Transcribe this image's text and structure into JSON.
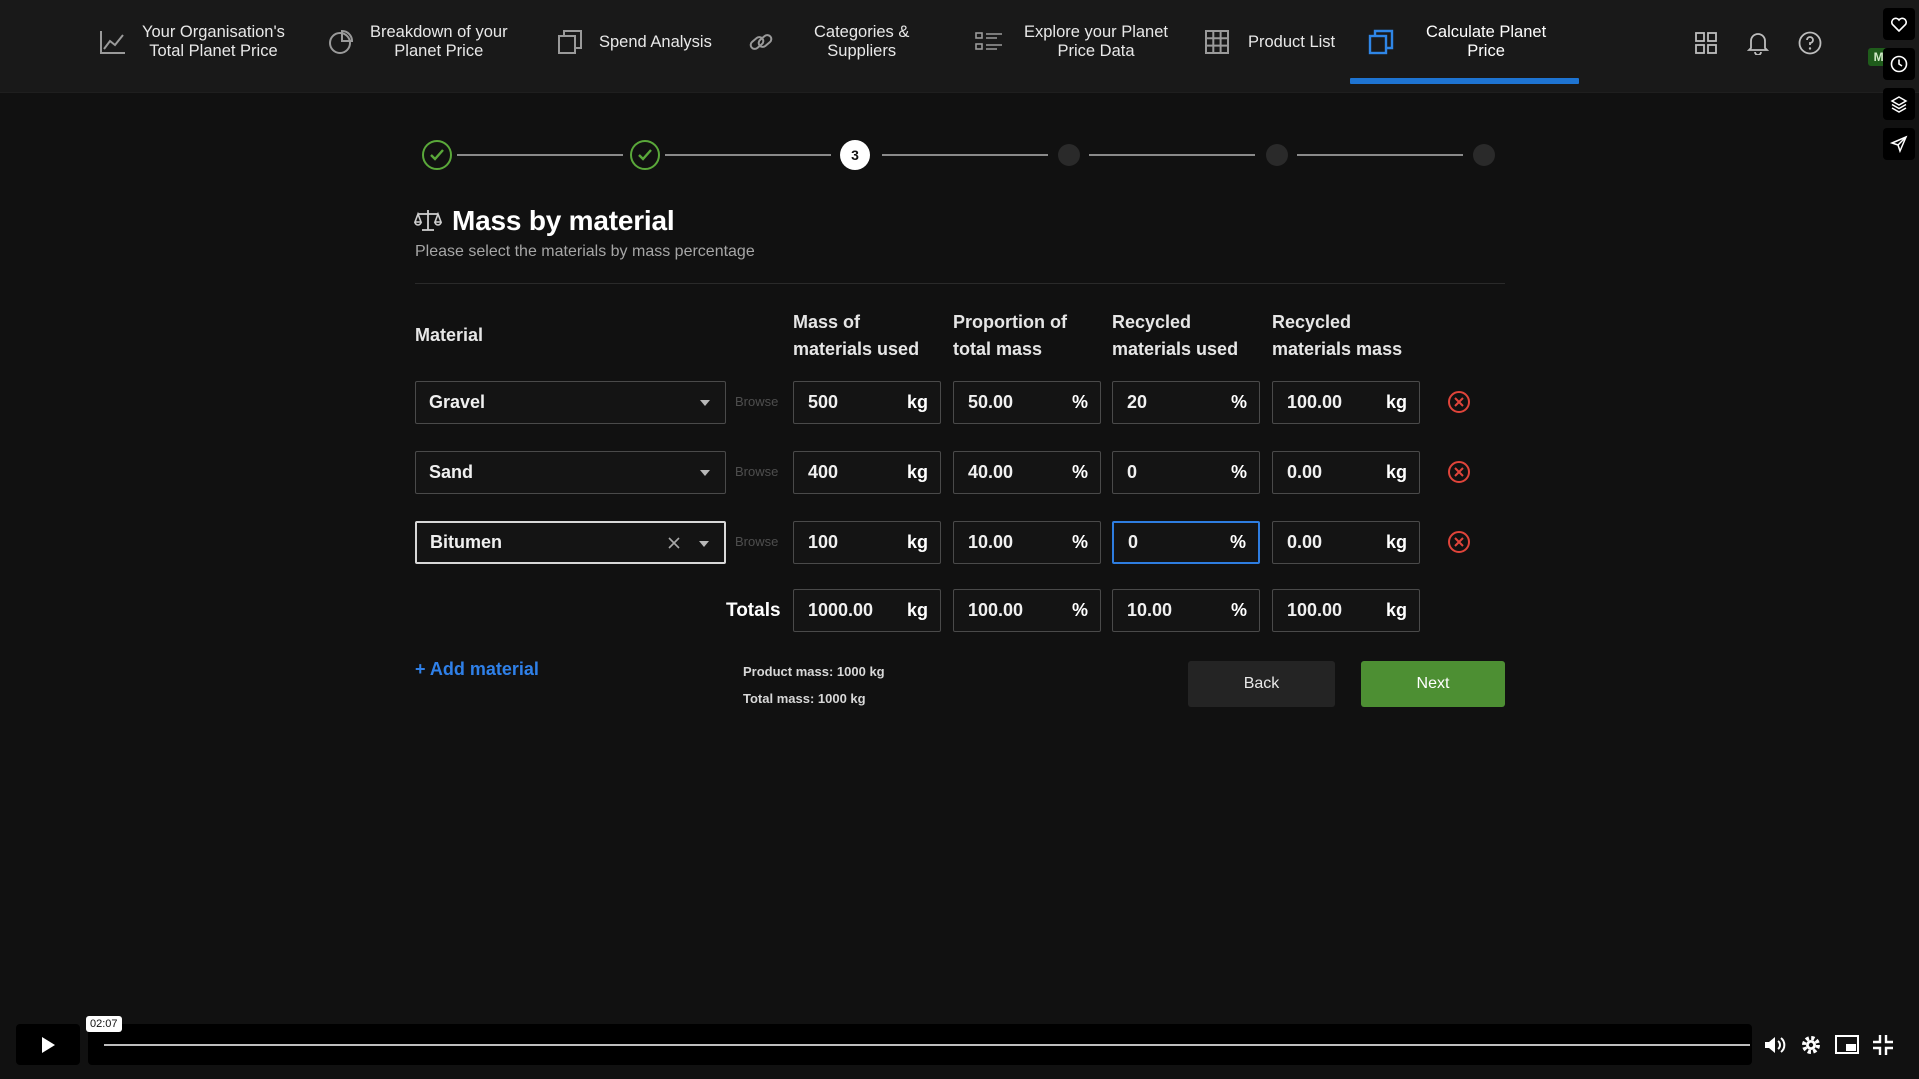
{
  "nav": {
    "items": [
      {
        "label": "Your Organisation's\nTotal Planet Price",
        "icon": "line-chart-icon"
      },
      {
        "label": "Breakdown of your\nPlanet Price",
        "icon": "pie-chart-icon"
      },
      {
        "label": "Spend Analysis",
        "icon": "copy-icon"
      },
      {
        "label": "Categories &\nSuppliers",
        "icon": "link-icon"
      },
      {
        "label": "Explore your Planet\nPrice Data",
        "icon": "list-icon"
      },
      {
        "label": "Product List",
        "icon": "grid-icon"
      },
      {
        "label": "Calculate Planet\nPrice",
        "icon": "copy-icon",
        "active": true
      }
    ],
    "right_icons": [
      "apps-icon",
      "bell-icon",
      "help-icon"
    ]
  },
  "overlay": {
    "badge_text": "Mi",
    "side_icons": [
      "heart-icon",
      "clock-icon",
      "layers-icon",
      "send-icon"
    ]
  },
  "stepper": {
    "current_label": "3",
    "steps": [
      "done",
      "done",
      "current",
      "future",
      "future",
      "future"
    ]
  },
  "header": {
    "title": "Mass by material",
    "subtitle": "Please select the materials by mass percentage",
    "icon": "scale-icon"
  },
  "table": {
    "headers": {
      "material": "Material",
      "mass": "Mass of\nmaterials used",
      "proportion": "Proportion of\ntotal mass",
      "recycled_used": "Recycled\nmaterials used",
      "recycled_mass": "Recycled\nmaterials mass"
    },
    "browse_label": "Browse",
    "rows": [
      {
        "material": "Gravel",
        "mass": "500",
        "mass_unit": "kg",
        "proportion": "50.00",
        "proportion_unit": "%",
        "recycled_used": "20",
        "recycled_used_unit": "%",
        "recycled_mass": "100.00",
        "recycled_mass_unit": "kg"
      },
      {
        "material": "Sand",
        "mass": "400",
        "mass_unit": "kg",
        "proportion": "40.00",
        "proportion_unit": "%",
        "recycled_used": "0",
        "recycled_used_unit": "%",
        "recycled_mass": "0.00",
        "recycled_mass_unit": "kg"
      },
      {
        "material": "Bitumen",
        "mass": "100",
        "mass_unit": "kg",
        "proportion": "10.00",
        "proportion_unit": "%",
        "recycled_used": "0",
        "recycled_used_unit": "%",
        "recycled_mass": "0.00",
        "recycled_mass_unit": "kg"
      }
    ],
    "totals": {
      "label": "Totals",
      "mass": "1000.00",
      "mass_unit": "kg",
      "proportion": "100.00",
      "proportion_unit": "%",
      "recycled_used": "10.00",
      "recycled_used_unit": "%",
      "recycled_mass": "100.00",
      "recycled_mass_unit": "kg"
    }
  },
  "footer": {
    "add_material": "+ Add material",
    "product_mass": "Product mass: 1000 kg",
    "total_mass": "Total mass: 1000 kg",
    "back_label": "Back",
    "next_label": "Next"
  },
  "video": {
    "timecode": "02:07",
    "icons": [
      "play-icon",
      "volume-icon",
      "settings-icon",
      "pip-icon",
      "fullscreen-exit-icon"
    ]
  },
  "colors": {
    "background": "#111111",
    "accent_blue": "#1e74d2",
    "success_green": "#5aa83a",
    "next_button": "#4d8f33",
    "remove_red": "#e0443a"
  }
}
